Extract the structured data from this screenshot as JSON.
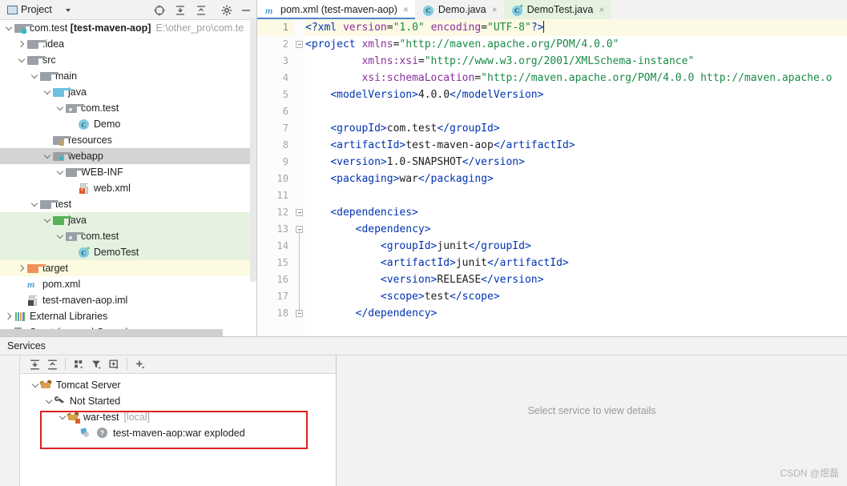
{
  "project": {
    "header": {
      "title": "Project",
      "icons": [
        "project-box-icon",
        "chevron-down-icon",
        "locate-icon",
        "expand-all-icon",
        "collapse-all-icon",
        "settings-gear-icon",
        "hide-icon"
      ]
    },
    "tree": [
      {
        "label": "com.test",
        "bold": "test-maven-aop",
        "path": "E:\\other_pro\\com.te",
        "icon": "module-folder-icon",
        "arrow": "down",
        "indent": 0,
        "highlight": "none"
      },
      {
        "label": ".idea",
        "icon": "folder-gray-icon",
        "arrow": "right",
        "indent": 1,
        "highlight": "none"
      },
      {
        "label": "src",
        "icon": "folder-gray-icon",
        "arrow": "down",
        "indent": 1,
        "highlight": "none"
      },
      {
        "label": "main",
        "icon": "folder-gray-icon",
        "arrow": "down",
        "indent": 2,
        "highlight": "none"
      },
      {
        "label": "java",
        "icon": "folder-source-blue-icon",
        "arrow": "down",
        "indent": 3,
        "highlight": "none"
      },
      {
        "label": "com.test",
        "icon": "package-icon",
        "arrow": "down",
        "indent": 4,
        "highlight": "none"
      },
      {
        "label": "Demo",
        "icon": "java-class-icon",
        "arrow": "none",
        "indent": 5,
        "highlight": "none"
      },
      {
        "label": "resources",
        "icon": "folder-resources-icon",
        "arrow": "none",
        "indent": 3,
        "highlight": "none"
      },
      {
        "label": "webapp",
        "icon": "folder-webapp-icon",
        "arrow": "down",
        "indent": 3,
        "highlight": "gray"
      },
      {
        "label": "WEB-INF",
        "icon": "folder-gray-icon",
        "arrow": "down",
        "indent": 4,
        "highlight": "none"
      },
      {
        "label": "web.xml",
        "icon": "xml-file-icon",
        "arrow": "none",
        "indent": 5,
        "highlight": "none"
      },
      {
        "label": "test",
        "icon": "folder-gray-icon",
        "arrow": "down",
        "indent": 2,
        "highlight": "none"
      },
      {
        "label": "java",
        "icon": "folder-test-green-icon",
        "arrow": "down",
        "indent": 3,
        "highlight": "green"
      },
      {
        "label": "com.test",
        "icon": "package-icon",
        "arrow": "down",
        "indent": 4,
        "highlight": "green"
      },
      {
        "label": "DemoTest",
        "icon": "java-test-class-icon",
        "arrow": "none",
        "indent": 5,
        "highlight": "green"
      },
      {
        "label": "target",
        "icon": "folder-orange-icon",
        "arrow": "right",
        "indent": 1,
        "highlight": "yellow"
      },
      {
        "label": "pom.xml",
        "icon": "maven-pom-icon",
        "arrow": "none",
        "indent": 1,
        "highlight": "none"
      },
      {
        "label": "test-maven-aop.iml",
        "icon": "iml-file-icon",
        "arrow": "none",
        "indent": 1,
        "highlight": "none"
      },
      {
        "label": "External Libraries",
        "icon": "libraries-icon",
        "arrow": "right",
        "indent": 0,
        "highlight": "none"
      },
      {
        "label": "Scratches and Consoles",
        "icon": "scratches-icon",
        "arrow": "none",
        "indent": 0,
        "highlight": "none"
      }
    ]
  },
  "editor": {
    "tabs": [
      {
        "label": "pom.xml (test-maven-aop)",
        "icon": "maven-pom-icon",
        "active": true,
        "green": false,
        "close": "×"
      },
      {
        "label": "Demo.java",
        "icon": "java-class-icon",
        "active": false,
        "green": false,
        "close": "×"
      },
      {
        "label": "DemoTest.java",
        "icon": "java-test-class-icon",
        "active": false,
        "green": true,
        "close": "×"
      }
    ],
    "line_numbers": [
      "1",
      "2",
      "3",
      "4",
      "5",
      "6",
      "7",
      "8",
      "9",
      "10",
      "11",
      "12",
      "13",
      "14",
      "15",
      "16",
      "17",
      "18"
    ],
    "current_line": 1,
    "lines": [
      {
        "n": 1,
        "segments": [
          {
            "t": "<?xml ",
            "c": "pi"
          },
          {
            "t": "version",
            "c": "at"
          },
          {
            "t": "=",
            "c": "tx"
          },
          {
            "t": "\"1.0\"",
            "c": "st"
          },
          {
            "t": " ",
            "c": "tx"
          },
          {
            "t": "encoding",
            "c": "at"
          },
          {
            "t": "=",
            "c": "tx"
          },
          {
            "t": "\"UTF-8\"",
            "c": "st"
          },
          {
            "t": "?>",
            "c": "pi"
          }
        ],
        "caret": true
      },
      {
        "n": 2,
        "segments": [
          {
            "t": "<project ",
            "c": "tg"
          },
          {
            "t": "xmlns",
            "c": "at"
          },
          {
            "t": "=",
            "c": "tx"
          },
          {
            "t": "\"http://maven.apache.org/POM/4.0.0\"",
            "c": "st"
          }
        ]
      },
      {
        "n": 3,
        "segments": [
          {
            "t": "         ",
            "c": "tx"
          },
          {
            "t": "xmlns:xsi",
            "c": "at"
          },
          {
            "t": "=",
            "c": "tx"
          },
          {
            "t": "\"http://www.w3.org/2001/XMLSchema-instance\"",
            "c": "st"
          }
        ]
      },
      {
        "n": 4,
        "segments": [
          {
            "t": "         ",
            "c": "tx"
          },
          {
            "t": "xsi:schemaLocation",
            "c": "at"
          },
          {
            "t": "=",
            "c": "tx"
          },
          {
            "t": "\"http://maven.apache.org/POM/4.0.0 http://maven.apache.o",
            "c": "st"
          }
        ]
      },
      {
        "n": 5,
        "segments": [
          {
            "t": "    ",
            "c": "tx"
          },
          {
            "t": "<modelVersion>",
            "c": "tg"
          },
          {
            "t": "4.0.0",
            "c": "tx"
          },
          {
            "t": "</modelVersion>",
            "c": "tg"
          }
        ]
      },
      {
        "n": 6,
        "segments": []
      },
      {
        "n": 7,
        "segments": [
          {
            "t": "    ",
            "c": "tx"
          },
          {
            "t": "<groupId>",
            "c": "tg"
          },
          {
            "t": "com.test",
            "c": "tx"
          },
          {
            "t": "</groupId>",
            "c": "tg"
          }
        ]
      },
      {
        "n": 8,
        "segments": [
          {
            "t": "    ",
            "c": "tx"
          },
          {
            "t": "<artifactId>",
            "c": "tg"
          },
          {
            "t": "test-maven-aop",
            "c": "tx"
          },
          {
            "t": "</artifactId>",
            "c": "tg"
          }
        ]
      },
      {
        "n": 9,
        "segments": [
          {
            "t": "    ",
            "c": "tx"
          },
          {
            "t": "<version>",
            "c": "tg"
          },
          {
            "t": "1.0-SNAPSHOT",
            "c": "tx"
          },
          {
            "t": "</version>",
            "c": "tg"
          }
        ]
      },
      {
        "n": 10,
        "segments": [
          {
            "t": "    ",
            "c": "tx"
          },
          {
            "t": "<packaging>",
            "c": "tg"
          },
          {
            "t": "war",
            "c": "tx"
          },
          {
            "t": "</packaging>",
            "c": "tg"
          }
        ]
      },
      {
        "n": 11,
        "segments": []
      },
      {
        "n": 12,
        "segments": [
          {
            "t": "    ",
            "c": "tx"
          },
          {
            "t": "<dependencies>",
            "c": "tg"
          }
        ]
      },
      {
        "n": 13,
        "segments": [
          {
            "t": "        ",
            "c": "tx"
          },
          {
            "t": "<dependency>",
            "c": "tg"
          }
        ]
      },
      {
        "n": 14,
        "segments": [
          {
            "t": "            ",
            "c": "tx"
          },
          {
            "t": "<groupId>",
            "c": "tg"
          },
          {
            "t": "junit",
            "c": "tx"
          },
          {
            "t": "</groupId>",
            "c": "tg"
          }
        ]
      },
      {
        "n": 15,
        "segments": [
          {
            "t": "            ",
            "c": "tx"
          },
          {
            "t": "<artifactId>",
            "c": "tg"
          },
          {
            "t": "junit",
            "c": "tx"
          },
          {
            "t": "</artifactId>",
            "c": "tg"
          }
        ]
      },
      {
        "n": 16,
        "segments": [
          {
            "t": "            ",
            "c": "tx"
          },
          {
            "t": "<version>",
            "c": "tg"
          },
          {
            "t": "RELEASE",
            "c": "tx"
          },
          {
            "t": "</version>",
            "c": "tg"
          }
        ]
      },
      {
        "n": 17,
        "segments": [
          {
            "t": "            ",
            "c": "tx"
          },
          {
            "t": "<scope>",
            "c": "tg"
          },
          {
            "t": "test",
            "c": "tx"
          },
          {
            "t": "</scope>",
            "c": "tg"
          }
        ]
      },
      {
        "n": 18,
        "segments": [
          {
            "t": "        ",
            "c": "tx"
          },
          {
            "t": "</dependency>",
            "c": "tg"
          }
        ]
      }
    ]
  },
  "services": {
    "title": "Services",
    "toolbar_icons": [
      "expand-all-icon",
      "collapse-all-icon",
      "group-by-icon",
      "filter-icon",
      "add-tab-icon",
      "add-service-icon"
    ],
    "tree": [
      {
        "label": "Tomcat Server",
        "icon": "tomcat-icon",
        "arrow": "down",
        "indent": 0,
        "suffix": ""
      },
      {
        "label": "Not Started",
        "icon": "wrench-icon",
        "arrow": "down",
        "indent": 1,
        "suffix": ""
      },
      {
        "label": "war-test",
        "icon": "tomcat-warn-icon",
        "arrow": "down",
        "indent": 2,
        "suffix": "[local]"
      },
      {
        "label": "test-maven-aop:war exploded",
        "icon": "deployment-icon",
        "arrow": "none",
        "indent": 3,
        "suffix": ""
      }
    ],
    "detail_placeholder": "Select service to view details",
    "highlight_color": "#e02020"
  },
  "watermark": "CSDN @煜磊"
}
